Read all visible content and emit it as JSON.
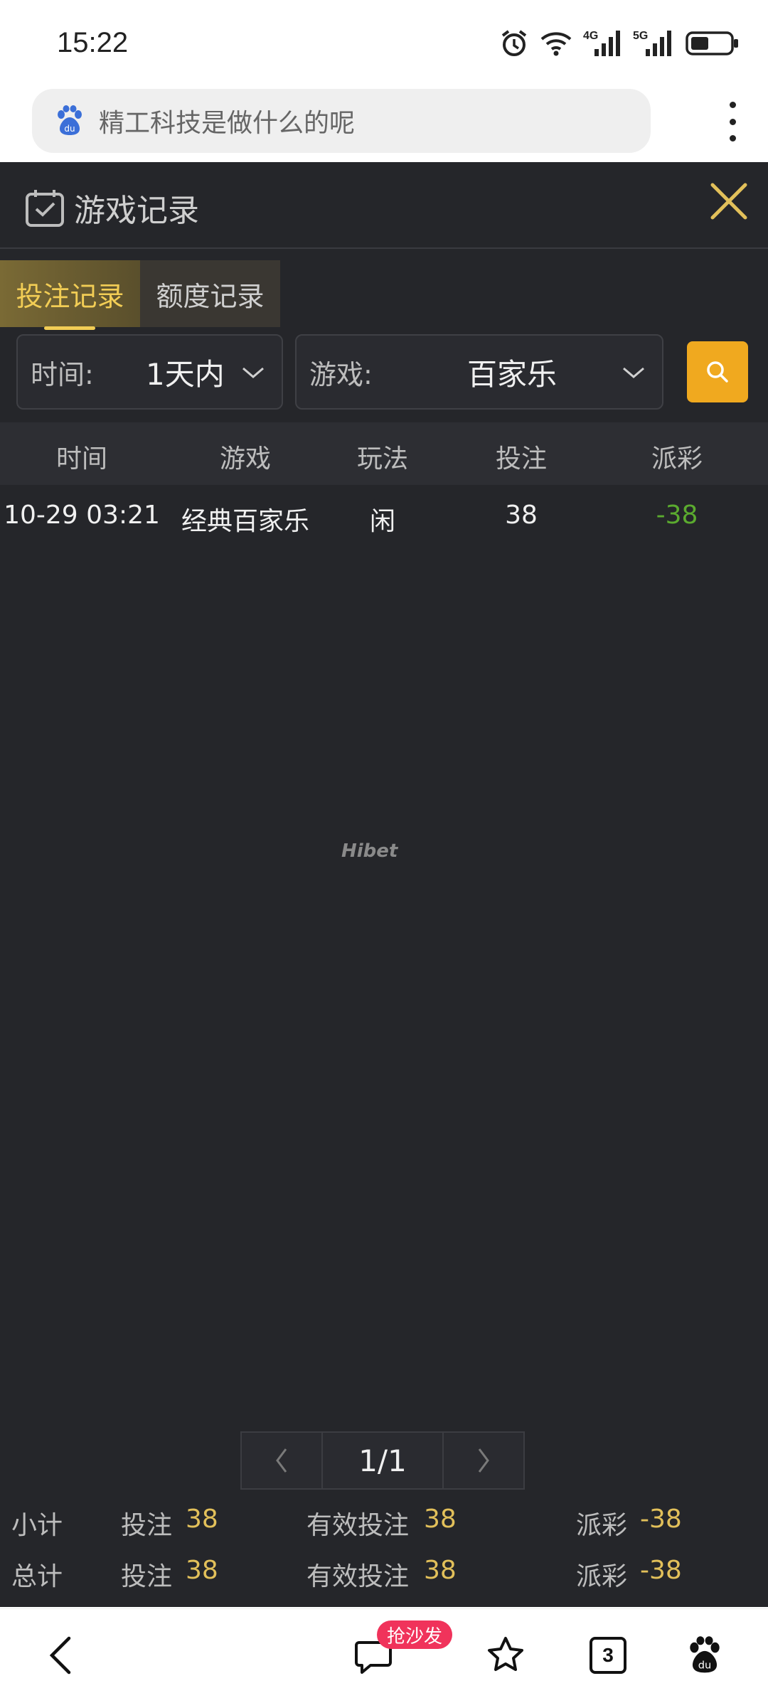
{
  "status_bar": {
    "time": "15:22",
    "net1": "4G",
    "net2": "5G"
  },
  "browser": {
    "search_text": "精工科技是做什么的呢"
  },
  "panel": {
    "title": "游戏记录",
    "tabs": [
      {
        "label": "投注记录",
        "active": true
      },
      {
        "label": "额度记录",
        "active": false
      }
    ],
    "filters": {
      "time_label": "时间:",
      "time_value": "1天内",
      "game_label": "游戏:",
      "game_value": "百家乐"
    },
    "table": {
      "headers": [
        "时间",
        "游戏",
        "玩法",
        "投注",
        "派彩"
      ],
      "rows": [
        {
          "time": "10-29 03:21",
          "game": "经典百家乐",
          "play": "闲",
          "bet": "38",
          "payout": "-38"
        }
      ]
    },
    "watermark": "Hibet",
    "pager": {
      "current": "1/1"
    },
    "subtotal": {
      "label": "小计",
      "bet_label": "投注",
      "bet": "38",
      "valid_label": "有效投注",
      "valid": "38",
      "payout_label": "派彩",
      "payout": "-38"
    },
    "total": {
      "label": "总计",
      "bet_label": "投注",
      "bet": "38",
      "valid_label": "有效投注",
      "valid": "38",
      "payout_label": "派彩",
      "payout": "-38"
    }
  },
  "bottom_nav": {
    "badge": "抢沙发",
    "tab_count": "3"
  },
  "colors": {
    "panel_bg": "#25262a",
    "accent_gold": "#f2cd55",
    "search_btn": "#f0a91f",
    "negative": "#5bab2f",
    "badge": "#f0335b"
  }
}
